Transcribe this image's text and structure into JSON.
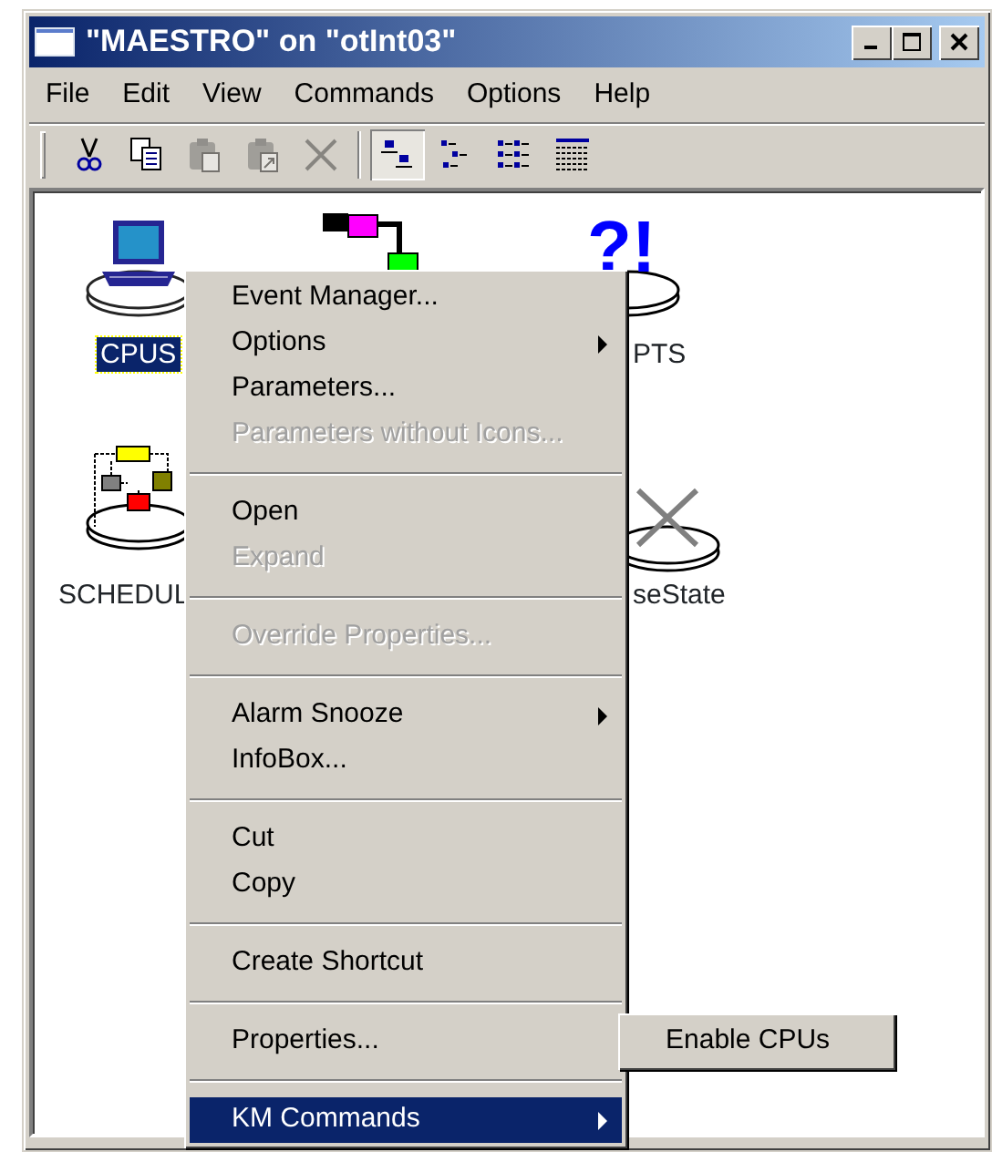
{
  "window": {
    "title": "\"MAESTRO\" on \"otInt03\""
  },
  "menubar": [
    "File",
    "Edit",
    "View",
    "Commands",
    "Options",
    "Help"
  ],
  "toolbar": [
    {
      "kind": "cut",
      "disabled": false
    },
    {
      "kind": "copy",
      "disabled": false
    },
    {
      "kind": "paste",
      "disabled": true
    },
    {
      "kind": "paste-shortcut",
      "disabled": true
    },
    {
      "kind": "delete",
      "disabled": true
    },
    {
      "kind": "separator"
    },
    {
      "kind": "large-icons",
      "selected": true
    },
    {
      "kind": "small-icons",
      "selected": false
    },
    {
      "kind": "list",
      "selected": false
    },
    {
      "kind": "details",
      "selected": false
    }
  ],
  "icons": [
    {
      "kind": "computer",
      "label": "CPUS",
      "selected": true
    },
    {
      "kind": "network",
      "selected": false
    },
    {
      "kind": "help",
      "glyph": "?!",
      "label": "PTS",
      "selected": false
    },
    {
      "kind": "flowchart",
      "label": "SCHEDUL",
      "selected": false
    },
    {
      "kind": "cross",
      "label": "seState",
      "selected": false
    }
  ],
  "context_menu": [
    {
      "kind": "item",
      "label": "Event Manager...",
      "disabled": false,
      "submenu": false,
      "selected": false
    },
    {
      "kind": "item",
      "label": "Options",
      "disabled": false,
      "submenu": true,
      "selected": false
    },
    {
      "kind": "item",
      "label": "Parameters...",
      "disabled": false,
      "submenu": false,
      "selected": false
    },
    {
      "kind": "item",
      "label": "Parameters without Icons...",
      "disabled": true,
      "submenu": false,
      "selected": false
    },
    {
      "kind": "separator"
    },
    {
      "kind": "item",
      "label": "Open",
      "disabled": false,
      "submenu": false,
      "selected": false
    },
    {
      "kind": "item",
      "label": "Expand",
      "disabled": true,
      "submenu": false,
      "selected": false
    },
    {
      "kind": "separator"
    },
    {
      "kind": "item",
      "label": "Override Properties...",
      "disabled": true,
      "submenu": false,
      "selected": false
    },
    {
      "kind": "separator"
    },
    {
      "kind": "item",
      "label": "Alarm Snooze",
      "disabled": false,
      "submenu": true,
      "selected": false
    },
    {
      "kind": "item",
      "label": "InfoBox...",
      "disabled": false,
      "submenu": false,
      "selected": false
    },
    {
      "kind": "separator"
    },
    {
      "kind": "item",
      "label": "Cut",
      "disabled": false,
      "submenu": false,
      "selected": false
    },
    {
      "kind": "item",
      "label": "Copy",
      "disabled": false,
      "submenu": false,
      "selected": false
    },
    {
      "kind": "separator"
    },
    {
      "kind": "item",
      "label": "Create Shortcut",
      "disabled": false,
      "submenu": false,
      "selected": false
    },
    {
      "kind": "separator"
    },
    {
      "kind": "item",
      "label": "Properties...",
      "disabled": false,
      "submenu": false,
      "selected": false
    },
    {
      "kind": "separator"
    },
    {
      "kind": "item",
      "label": "KM Commands",
      "disabled": false,
      "submenu": true,
      "selected": true
    }
  ],
  "submenu": [
    {
      "label": "Enable CPUs",
      "selected": false
    }
  ]
}
